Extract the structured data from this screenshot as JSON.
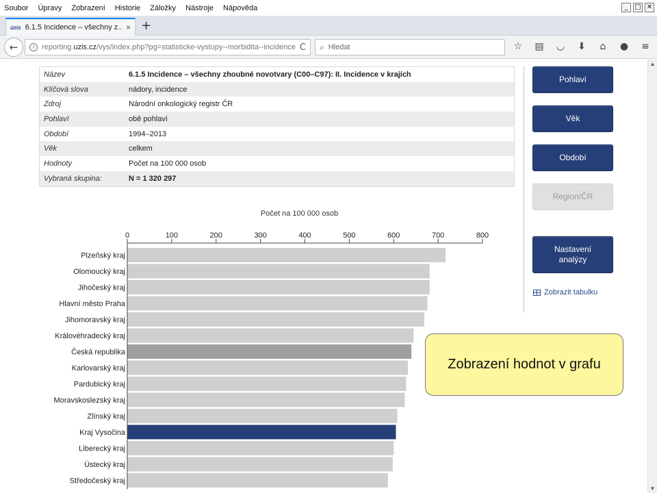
{
  "menubar": {
    "items": [
      "Soubor",
      "Úpravy",
      "Zobrazení",
      "Historie",
      "Záložky",
      "Nástroje",
      "Nápověda"
    ],
    "window_controls": [
      "_",
      "□",
      "✕"
    ]
  },
  "tab": {
    "favicon": "úzis",
    "title": "6.1.5 Incidence – všechny z...",
    "close": "×",
    "new_tab": "+"
  },
  "navbar": {
    "back": "←",
    "url_prefix": "reporting.",
    "url_host": "uzis.cz",
    "url_rest": "/vys/index.php?pg=statisticke-vystupy--morbidita--incidence-dk",
    "reload": "C",
    "search_placeholder": "Hledat",
    "icons": [
      "star-icon",
      "reading-list-icon",
      "pocket-icon",
      "download-icon",
      "home-icon",
      "chat-icon",
      "menu-icon"
    ]
  },
  "meta": [
    {
      "key": "Název",
      "value": "6.1.5 Incidence – všechny zhoubné novotvary (C00–C97): II. Incidence v krajích",
      "bold": true
    },
    {
      "key": "Klíčová slova",
      "value": "nádory, incidence",
      "bold": false
    },
    {
      "key": "Zdroj",
      "value": "Národní onkologický registr ČR",
      "bold": false
    },
    {
      "key": "Pohlaví",
      "value": "obě pohlaví",
      "bold": false
    },
    {
      "key": "Období",
      "value": "1994–2013",
      "bold": false
    },
    {
      "key": "Věk",
      "value": "celkem",
      "bold": false
    },
    {
      "key": "Hodnoty",
      "value": "Počet na 100 000 osob",
      "bold": false
    },
    {
      "key": "Vybraná skupina:",
      "value": "N = 1 320 297",
      "bold": true
    }
  ],
  "sidebar": {
    "buttons": [
      {
        "label": "Pohlaví",
        "disabled": false
      },
      {
        "label": "Věk",
        "disabled": false
      },
      {
        "label": "Období",
        "disabled": false
      },
      {
        "label": "Region/ČR",
        "disabled": true
      },
      {
        "label": "Nastavení analýzy",
        "disabled": false
      }
    ],
    "table_link": "Zobrazit tabulku"
  },
  "callout": {
    "text": "Zobrazení hodnot v grafu"
  },
  "chart_data": {
    "type": "bar",
    "orientation": "horizontal",
    "title": "Počet na 100 000 osob",
    "xlim": [
      0,
      800
    ],
    "xticks": [
      0,
      100,
      200,
      300,
      400,
      500,
      600,
      700,
      800
    ],
    "categories": [
      "Plzeňský kraj",
      "Olomoucký kraj",
      "Jihočeský kraj",
      "Hlavní město Praha",
      "Jihomoravský kraj",
      "Královéhradecký kraj",
      "Česká republika",
      "Karlovarský kraj",
      "Pardubický kraj",
      "Moravskoslezský kraj",
      "Zlínský kraj",
      "Kraj Vysočina",
      "Liberecký kraj",
      "Ústecký kraj",
      "Středočeský kraj"
    ],
    "values": [
      717,
      681,
      681,
      676,
      669,
      645,
      640,
      632,
      628,
      625,
      608,
      605,
      600,
      598,
      587
    ],
    "colors": {
      "default": "#cfcfcf",
      "reference": "#a0a0a0",
      "selected": "#263f78"
    },
    "reference_category": "Česká republika",
    "selected_category": "Kraj Vysočina"
  }
}
